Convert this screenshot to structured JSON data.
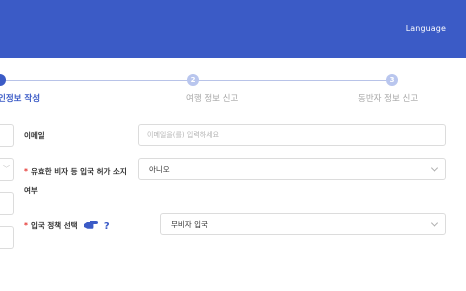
{
  "header": {
    "language_label": "Language",
    "bg_color": "#3b5bc6"
  },
  "stepper": {
    "steps": [
      {
        "number": "",
        "label": "인정보 작성",
        "active": true
      },
      {
        "number": "2",
        "label": "여행 정보 신고",
        "active": false
      },
      {
        "number": "3",
        "label": "동반자 정보 신고",
        "active": false
      }
    ]
  },
  "form": {
    "email": {
      "label": "이메일",
      "placeholder": "이메일을(를) 입력하세요"
    },
    "visa": {
      "label_line1": "유효한 비자 등 입국 허가 소지",
      "label_line2": "여부",
      "required_mark": "*",
      "value": "아니오"
    },
    "entry_policy": {
      "label": "입국 정책 선택",
      "required_mark": "*",
      "help": "?",
      "value": "무비자 입국"
    }
  },
  "icons": {
    "pointing_hand": "hand-pointing-icon",
    "help": "question-icon",
    "chevron": "chevron-down-icon"
  }
}
